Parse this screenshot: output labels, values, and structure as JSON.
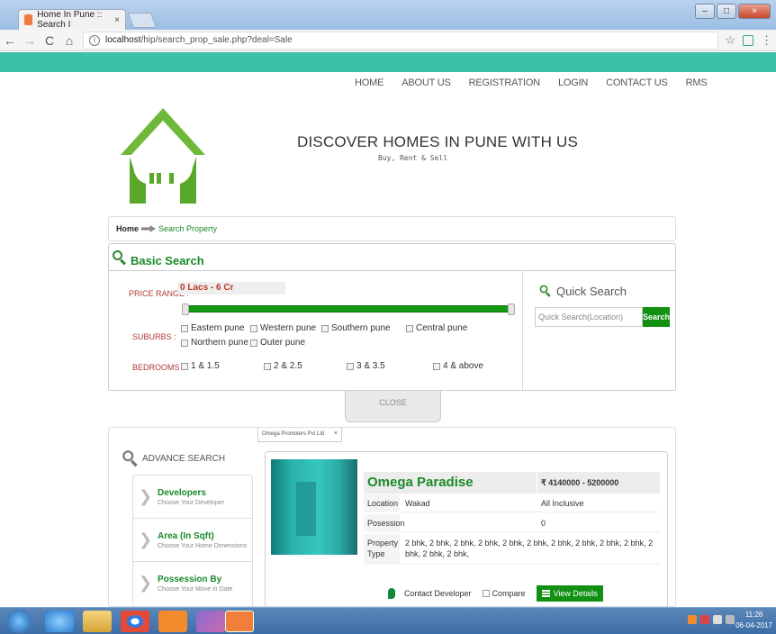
{
  "browser": {
    "tab_title": "Home In Pune :: Search I",
    "tab_close": "×",
    "url_prefix": "localhost",
    "url_path": "/hip/search_prop_sale.php?deal=Sale",
    "info_glyph": "i",
    "nav_back": "←",
    "nav_forward": "→",
    "nav_reload": "C",
    "nav_home": "⌂",
    "star": "☆",
    "menu": "⋮"
  },
  "nav": [
    "HOME",
    "ABOUT US",
    "REGISTRATION",
    "LOGIN",
    "CONTACT US",
    "RMS"
  ],
  "header": {
    "tagline": "DISCOVER HOMES IN PUNE WITH US",
    "subtag": "Buy, Rent & Sell"
  },
  "breadcrumb": {
    "home": "Home",
    "current": "Search Property"
  },
  "basic_search": {
    "title": "Basic Search",
    "price_label": "PRICE RANGE :",
    "price_value": "0 Lacs - 6 Cr",
    "suburbs_label": "SUBURBS :",
    "suburbs": [
      "Eastern pune",
      "Western pune",
      "Southern pune",
      "Central pune",
      "Northern pune",
      "Outer pune"
    ],
    "bedrooms_label": "BEDROOMS :",
    "bedrooms": [
      "1 & 1.5",
      "2 & 2.5",
      "3 & 3.5",
      "4 & above"
    ],
    "quick_title": "Quick Search",
    "quick_placeholder": "Quick Search(Location)",
    "quick_button": "Search",
    "close": "CLOSE"
  },
  "advance": {
    "title": "ADVANCE SEARCH",
    "filters": [
      {
        "title": "Developers",
        "sub": "Choose Your Developer"
      },
      {
        "title": "Area (In Sqft)",
        "sub": "Choose Your Home Dimensions"
      },
      {
        "title": "Possession By",
        "sub": "Choose Your Move in Date"
      }
    ],
    "chip": "Omega Promoters Pvt Ltd",
    "chip_close": "×"
  },
  "property": {
    "name": "Omega Paradise",
    "price": "₹ 4140000 - 5200000",
    "location_label": "Location",
    "location": "Wakad",
    "inclusive": "All Inclusive",
    "possession_label": "Posession",
    "possession": "0",
    "type_label": "Property Type",
    "type": "2 bhk, 2 bhk, 2 bhk, 2 bhk, 2 bhk, 2 bhk, 2 bhk, 2 bhk, 2 bhk, 2 bhk, 2 bhk, 2 bhk, 2 bhk,",
    "contact": "Contact Developer",
    "compare": "Compare",
    "view": "View Details"
  },
  "taskbar": {
    "time": "11:28",
    "date": "06-04-2017"
  },
  "colors": {
    "teal": "#3cc0a7",
    "green": "#129012",
    "title_green": "#1a8a2a"
  }
}
